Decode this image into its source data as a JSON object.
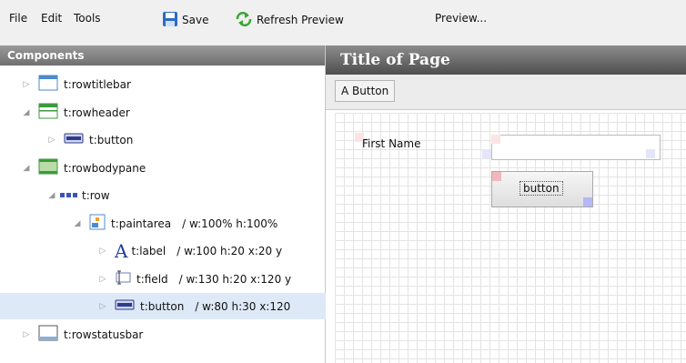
{
  "menubar": {
    "file": "File",
    "edit": "Edit",
    "tools": "Tools",
    "save": "Save",
    "refresh": "Refresh Preview",
    "preview": "Preview..."
  },
  "components": {
    "header": "Components",
    "items": [
      {
        "label": "t:rowtitlebar",
        "props": "",
        "icon": "rowtitlebar-icon"
      },
      {
        "label": "t:rowheader",
        "props": "",
        "icon": "rowheader-icon"
      },
      {
        "label": "t:button",
        "props": "",
        "icon": "button-icon"
      },
      {
        "label": "t:rowbodypane",
        "props": "",
        "icon": "rowbodypane-icon"
      },
      {
        "label": "t:row",
        "props": "",
        "icon": "row-icon"
      },
      {
        "label": "t:paintarea",
        "props": "/ w:100% h:100%",
        "icon": "paintarea-icon"
      },
      {
        "label": "t:label",
        "props": "/ w:100 h:20 x:20 y",
        "icon": "label-icon"
      },
      {
        "label": "t:field",
        "props": "/ w:130 h:20 x:120 y",
        "icon": "field-icon"
      },
      {
        "label": "t:button",
        "props": "/ w:80 h:30 x:120",
        "icon": "button-icon"
      },
      {
        "label": "t:rowstatusbar",
        "props": "",
        "icon": "rowstatusbar-icon"
      }
    ]
  },
  "preview": {
    "title": "Title of Page",
    "a_button": "A Button",
    "first_name_label": "First Name",
    "field_value": "",
    "button_label": "button"
  },
  "colors": {
    "selection": "#dde9f7",
    "marker_red": "#f0b7bd",
    "marker_blue": "#b5b8f5",
    "save_icon": "#2b6cc4",
    "refresh_icon": "#3aa535"
  }
}
